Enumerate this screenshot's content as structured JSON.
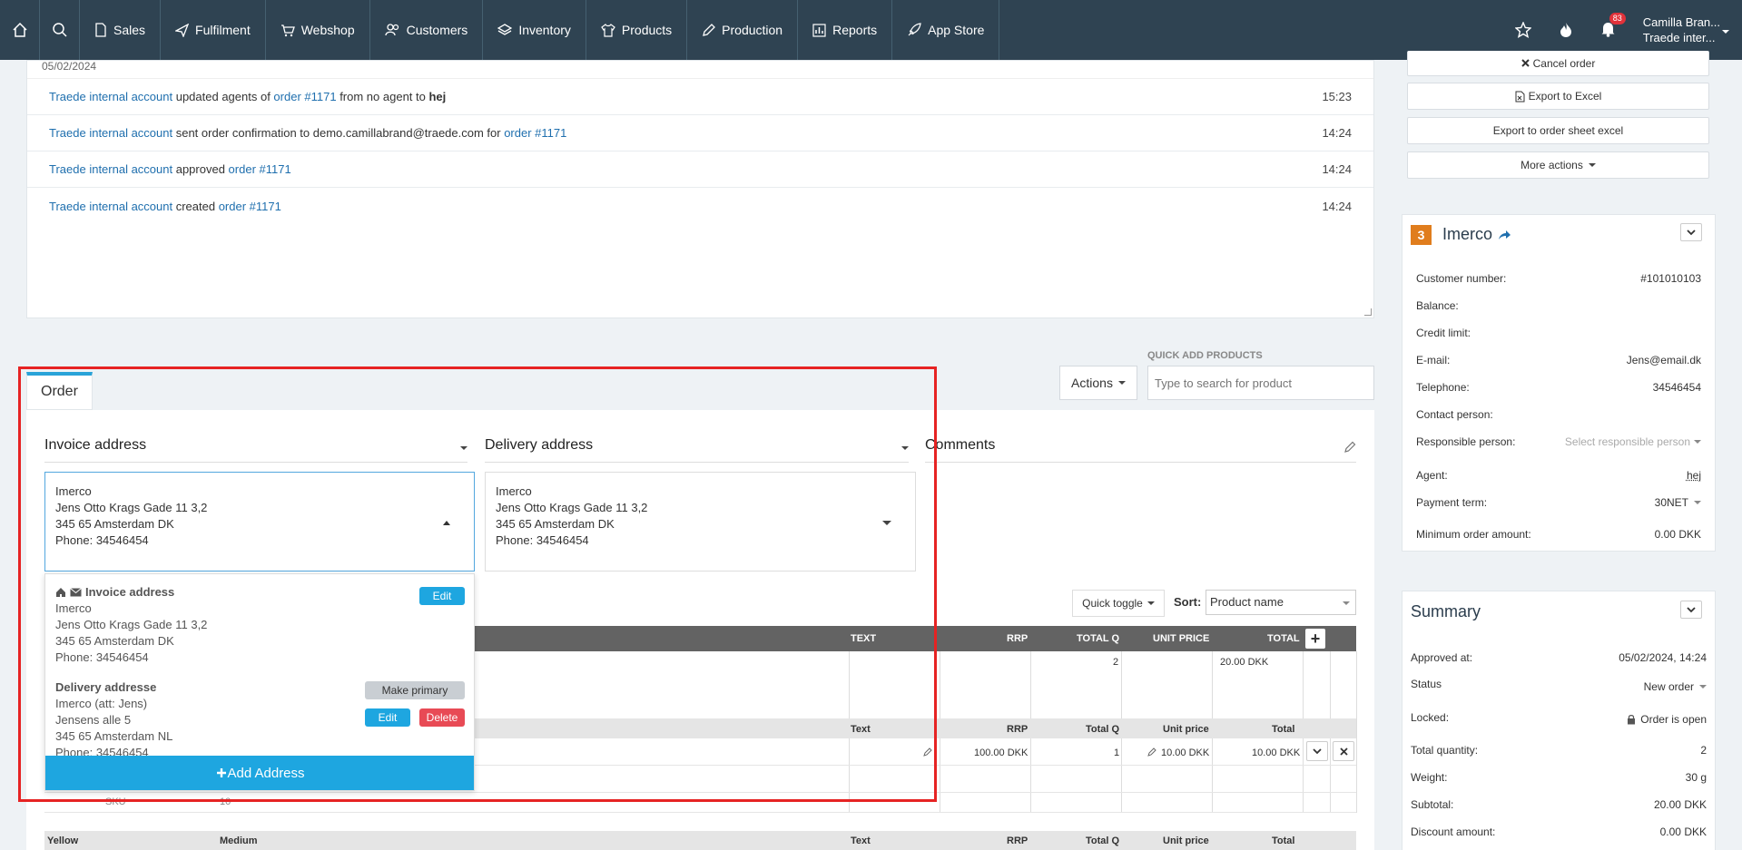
{
  "nav": {
    "items": [
      {
        "label": "Sales",
        "icon": "file-icon"
      },
      {
        "label": "Fulfilment",
        "icon": "plane-icon"
      },
      {
        "label": "Webshop",
        "icon": "cart-icon"
      },
      {
        "label": "Customers",
        "icon": "people-icon"
      },
      {
        "label": "Inventory",
        "icon": "layers-icon"
      },
      {
        "label": "Products",
        "icon": "shirt-icon"
      },
      {
        "label": "Production",
        "icon": "pencil-icon"
      },
      {
        "label": "Reports",
        "icon": "chart-icon"
      },
      {
        "label": "App Store",
        "icon": "rocket-icon"
      }
    ],
    "notification_count": "83",
    "user_name": "Camilla Bran...",
    "user_company": "Traede inter..."
  },
  "activity": {
    "date": "05/02/2024",
    "rows": [
      {
        "actor": "Traede internal account",
        "text1": " updated agents of ",
        "link": "order #1171",
        "text2": " from no agent to ",
        "bold": "hej",
        "time": "15:23"
      },
      {
        "actor": "Traede internal account",
        "text1": " sent order confirmation to demo.camillabrand@traede.com for ",
        "link": "order #1171",
        "text2": "",
        "bold": "",
        "time": "14:24"
      },
      {
        "actor": "Traede internal account",
        "text1": " approved ",
        "link": "order #1171",
        "text2": "",
        "bold": "",
        "time": "14:24"
      },
      {
        "actor": "Traede internal account",
        "text1": " created ",
        "link": "order #1171",
        "text2": "",
        "bold": "",
        "time": "14:24"
      }
    ]
  },
  "order": {
    "tab_label": "Order",
    "actions_label": "Actions",
    "quick_add_label": "QUICK ADD PRODUCTS",
    "quick_add_placeholder": "Type to search for product",
    "invoice_heading": "Invoice address",
    "delivery_heading": "Delivery address",
    "comments_heading": "Comments",
    "invoice_box": [
      "Imerco",
      "Jens Otto Krags Gade 11 3,2",
      "345 65 Amsterdam DK",
      "Phone: 34546454"
    ],
    "delivery_box": [
      "Imerco",
      "Jens Otto Krags Gade 11 3,2",
      "345 65 Amsterdam DK",
      "Phone: 34546454"
    ],
    "dropdown": {
      "invoice_title": "Invoice address",
      "invoice_lines": [
        "Imerco",
        "Jens Otto Krags Gade 11 3,2",
        "345 65 Amsterdam DK",
        "Phone: 34546454"
      ],
      "edit_label": "Edit",
      "delivery_title": "Delivery addresse",
      "delivery_lines": [
        "Imerco (att: Jens)",
        "Jensens alle 5",
        "345 65 Amsterdam NL",
        "Phone: 34546454"
      ],
      "make_primary_label": "Make primary",
      "edit2_label": "Edit",
      "delete_label": "Delete",
      "add_label": "Add Address"
    },
    "quick_toggle_label": "Quick toggle",
    "sort_label": "Sort:",
    "sort_value": "Product name",
    "table_headers": {
      "text": "TEXT",
      "rrp": "RRP",
      "total_q": "TOTAL Q",
      "unit_price": "UNIT PRICE",
      "total": "TOTAL"
    },
    "summary_row": {
      "total_q": "2",
      "total": "20.00 DKK"
    },
    "sub_headers": {
      "text": "Text",
      "rrp": "RRP",
      "total_q": "Total Q",
      "unit_price": "Unit price",
      "total": "Total"
    },
    "line": {
      "rrp": "100.00 DKK",
      "qty": "1",
      "unit_price": "10.00 DKK",
      "total": "10.00 DKK"
    },
    "sku_label": "SKU",
    "sku_value": "10",
    "variant_headers": {
      "color": "Yellow",
      "size": "Medium",
      "text": "Text",
      "rrp": "RRP",
      "total_q": "Total Q",
      "unit_price": "Unit price",
      "total": "Total"
    }
  },
  "sidebar": {
    "buttons": {
      "cancel": "Cancel order",
      "export_excel": "Export to Excel",
      "export_sheet": "Export to order sheet excel",
      "more": "More actions"
    },
    "customer": {
      "badge": "3",
      "name": "Imerco",
      "rows": [
        {
          "label": "Customer number:",
          "value": "#101010103"
        },
        {
          "label": "Balance:",
          "value": ""
        },
        {
          "label": "Credit limit:",
          "value": ""
        },
        {
          "label": "E-mail:",
          "value": "Jens@email.dk"
        },
        {
          "label": "Telephone:",
          "value": "34546454"
        },
        {
          "label": "Contact person:",
          "value": ""
        }
      ],
      "responsible_label": "Responsible person:",
      "responsible_placeholder": "Select responsible person",
      "agent_label": "Agent:",
      "agent_value": "hej",
      "payment_label": "Payment term:",
      "payment_value": "30NET",
      "min_order_label": "Minimum order amount:",
      "min_order_value": "0.00 DKK"
    },
    "summary": {
      "title": "Summary",
      "approved_label": "Approved at:",
      "approved_value": "05/02/2024, 14:24",
      "status_label": "Status",
      "status_value": "New order",
      "locked_label": "Locked:",
      "locked_value": "Order is open",
      "rows": [
        {
          "label": "Total quantity:",
          "value": "2"
        },
        {
          "label": "Weight:",
          "value": "30 g"
        },
        {
          "label": "Subtotal:",
          "value": "20.00 DKK"
        },
        {
          "label": "Discount amount:",
          "value": "0.00 DKK"
        }
      ]
    }
  }
}
